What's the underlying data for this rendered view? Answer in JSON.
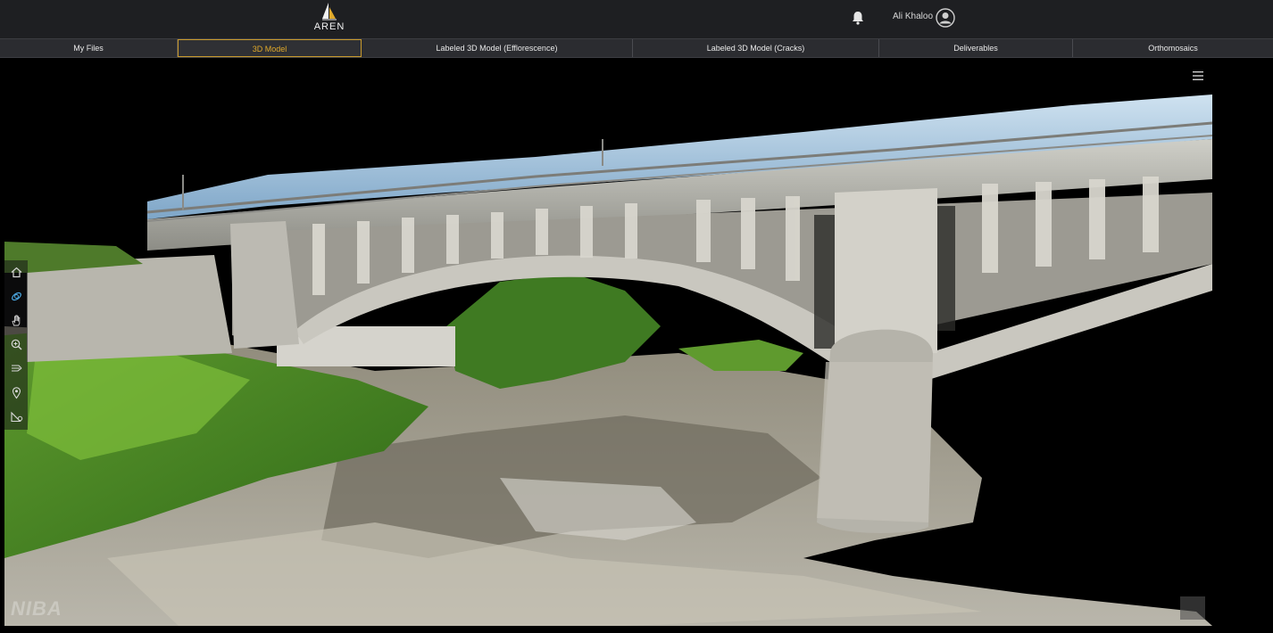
{
  "header": {
    "logo_text": "AREN",
    "user_name": "Ali Khaloo"
  },
  "tabs": [
    {
      "label": "My Files"
    },
    {
      "label": "3D Model",
      "active": true
    },
    {
      "label": "Labeled 3D Model (Efflorescence)"
    },
    {
      "label": "Labeled 3D Model (Cracks)"
    },
    {
      "label": "Deliverables"
    },
    {
      "label": "Orthomosaics"
    }
  ],
  "toolbar": {
    "tools": [
      "home-icon",
      "orbit-icon",
      "pan-hand-icon",
      "zoom-icon",
      "fly-icon",
      "location-pin-icon",
      "measure-icon"
    ]
  },
  "viewer": {
    "watermark": "NIBA",
    "colors": {
      "accent": "#e0a92a",
      "topbar": "#1e1f22",
      "tabbar": "#2b2c30"
    }
  }
}
